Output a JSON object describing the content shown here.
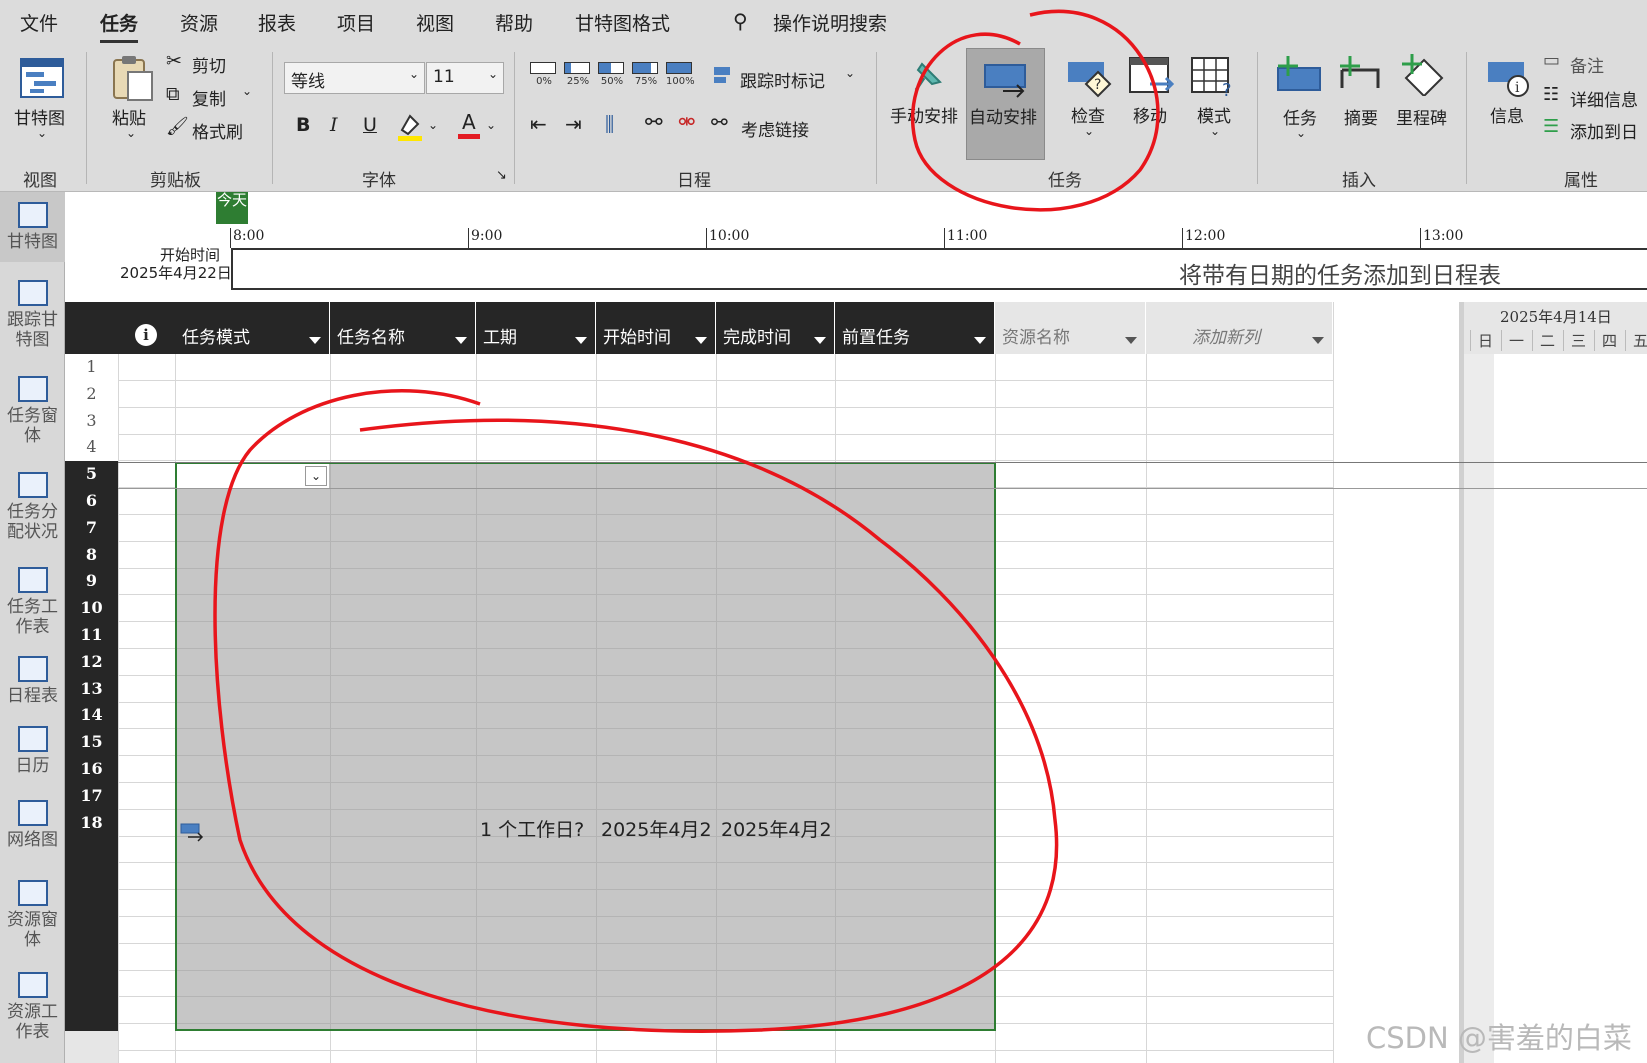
{
  "menu": {
    "file": "文件",
    "task": "任务",
    "resource": "资源",
    "report": "报表",
    "project": "项目",
    "view": "视图",
    "help": "帮助",
    "gantt_format": "甘特图格式",
    "search": "操作说明搜索"
  },
  "ribbon": {
    "view_group": {
      "gantt": "甘特图",
      "label": "视图"
    },
    "clipboard": {
      "paste": "粘贴",
      "cut": "剪切",
      "copy": "复制",
      "format_painter": "格式刷",
      "label": "剪贴板"
    },
    "font": {
      "family": "等线",
      "size": "11",
      "bold": "B",
      "italic": "I",
      "underline": "U",
      "font_color": "A",
      "label": "字体"
    },
    "schedule": {
      "pct": [
        "0%",
        "25%",
        "50%",
        "75%",
        "100%"
      ],
      "track": "跟踪时标记",
      "respect_links": "考虑链接",
      "label": "日程"
    },
    "tasks": {
      "manual": "手动安排",
      "auto": "自动安排",
      "inspect": "检查",
      "move": "移动",
      "mode": "模式",
      "label": "任务"
    },
    "insert": {
      "task": "任务",
      "summary": "摘要",
      "milestone": "里程碑",
      "label": "插入"
    },
    "properties": {
      "info": "信息",
      "notes": "备注",
      "details": "详细信息",
      "add_to_timeline": "添加到日",
      "label": "属性"
    }
  },
  "views": [
    "甘特图",
    "跟踪甘特图",
    "任务窗体",
    "任务分配状况",
    "任务工作表",
    "日程表",
    "日历",
    "网络图",
    "资源窗体",
    "资源工作表"
  ],
  "timeline": {
    "today": "今天",
    "start_label": "开始时间",
    "start_date": "2025年4月22日",
    "ticks": [
      "8:00",
      "9:00",
      "10:00",
      "11:00",
      "12:00",
      "13:00"
    ],
    "placeholder": "将带有日期的任务添加到日程表"
  },
  "grid": {
    "columns": [
      "任务模式",
      "任务名称",
      "工期",
      "开始时间",
      "完成时间",
      "前置任务",
      "资源名称",
      "添加新列"
    ],
    "row_numbers": [
      "1",
      "2",
      "3",
      "4",
      "5",
      "6",
      "7",
      "8",
      "9",
      "10",
      "11",
      "12",
      "13",
      "14",
      "15",
      "16",
      "17",
      "18"
    ],
    "row18": {
      "duration": "1 个工作日?",
      "start": "2025年4月2",
      "finish": "2025年4月2"
    }
  },
  "gantt_header": {
    "week": "2025年4月14日",
    "days": [
      "日",
      "一",
      "二",
      "三",
      "四",
      "五"
    ]
  },
  "watermark": "CSDN @害羞的白菜",
  "colors": {
    "annotation_red": "#e8151b",
    "header_dark": "#262626",
    "selection_gray": "#c6c6c6",
    "selection_border": "#2e7d32",
    "today_green": "#2e7d32"
  }
}
